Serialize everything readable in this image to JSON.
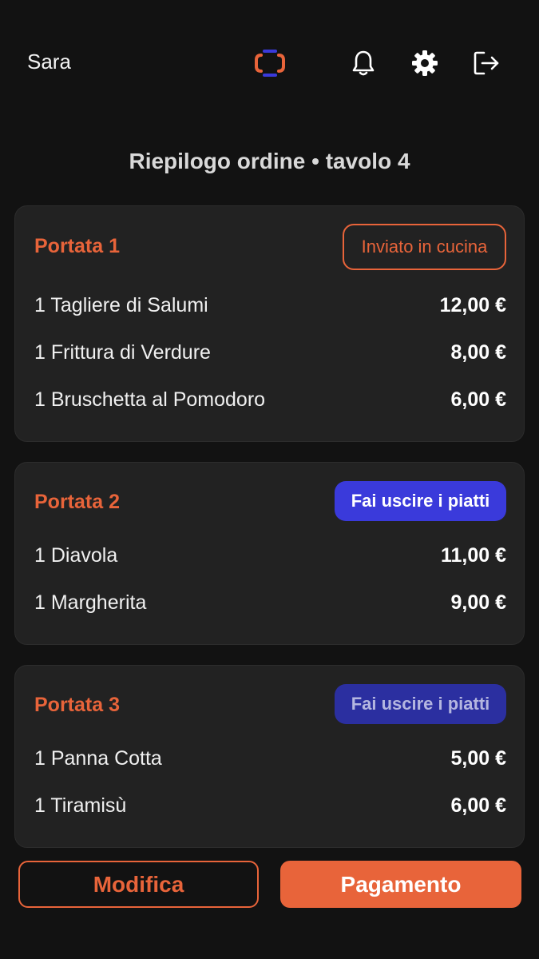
{
  "header": {
    "username": "Sara",
    "icons": [
      "logo-icon",
      "bell-icon",
      "gear-icon",
      "logout-icon"
    ]
  },
  "page_title": "Riepilogo ordine • tavolo 4",
  "courses": [
    {
      "title": "Portata 1",
      "status": "Inviato in cucina",
      "items": [
        {
          "name": "1 Tagliere di Salumi",
          "price": "12,00 €"
        },
        {
          "name": "1 Frittura di Verdure",
          "price": "8,00 €"
        },
        {
          "name": "1 Bruschetta al Pomodoro",
          "price": "6,00 €"
        }
      ]
    },
    {
      "title": "Portata 2",
      "status": "Fai uscire i piatti",
      "items": [
        {
          "name": "1 Diavola",
          "price": "11,00 €"
        },
        {
          "name": "1 Margherita",
          "price": "9,00 €"
        }
      ]
    },
    {
      "title": "Portata 3",
      "status": "Fai uscire i piatti",
      "items": [
        {
          "name": "1 Panna Cotta",
          "price": "5,00 €"
        },
        {
          "name": "1 Tiramisù",
          "price": "6,00 €"
        }
      ]
    }
  ],
  "actions": {
    "edit_label": "Modifica",
    "pay_label": "Pagamento"
  },
  "colors": {
    "accent": "#e8643a",
    "primary": "#3a3adb",
    "primary_disabled": "#2b2fa0",
    "background": "#121212",
    "card": "#222222"
  }
}
